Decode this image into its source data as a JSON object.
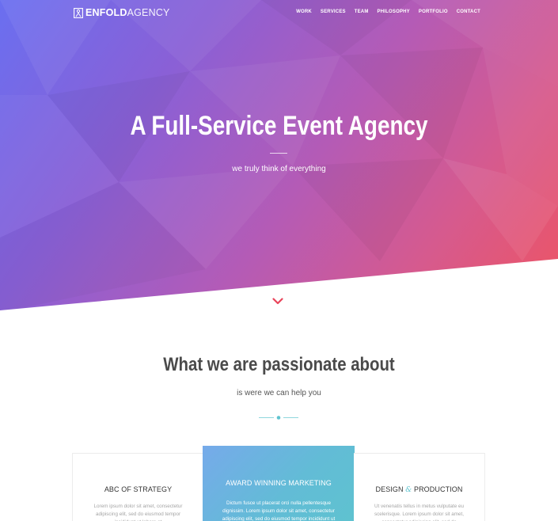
{
  "header": {
    "logo_bold": "ENFOLD",
    "logo_light": "AGENCY",
    "nav": [
      {
        "label": "WORK"
      },
      {
        "label": "SERVICES"
      },
      {
        "label": "TEAM"
      },
      {
        "label": "PHILOSOPHY"
      },
      {
        "label": "PORTFOLIO"
      },
      {
        "label": "CONTACT"
      }
    ]
  },
  "hero": {
    "title": "A Full-Service Event Agency",
    "subtitle": "we truly think of everything"
  },
  "icons": {
    "logo": "enfold-logo-mark-icon",
    "scroll": "chevron-down-icon",
    "divider": "dot-divider-ornament-icon"
  },
  "colors": {
    "gradient_start": "#6a6ff0",
    "gradient_end": "#ee5462",
    "accent": "#5ec3cf",
    "chevron": "#e9455b"
  },
  "passion": {
    "title": "What we are passionate about",
    "subtitle": "is were we can help you"
  },
  "cards": [
    {
      "title": "ABC OF STRATEGY",
      "text": "Lorem ipsum dolor sit amet, consectetur adipiscing elit, sed do eiusmod tempor incididunt ut labore et"
    },
    {
      "title": "AWARD WINNING MARKETING",
      "text": "Dictum fusce ut placerat orci nulla pellentesque dignissim. Lorem ipsum dolor sit amet, consectetur adipiscing elit, sed do eiusmod tempor incididunt ut"
    },
    {
      "title_part1": "DESIGN",
      "title_amp": "&",
      "title_part2": "PRODUCTION",
      "text": "Ut venenatis tellus in metus vulputate eu scelerisque. Lorem ipsum dolor sit amet, consectetur adipiscing elit, sed do"
    }
  ]
}
